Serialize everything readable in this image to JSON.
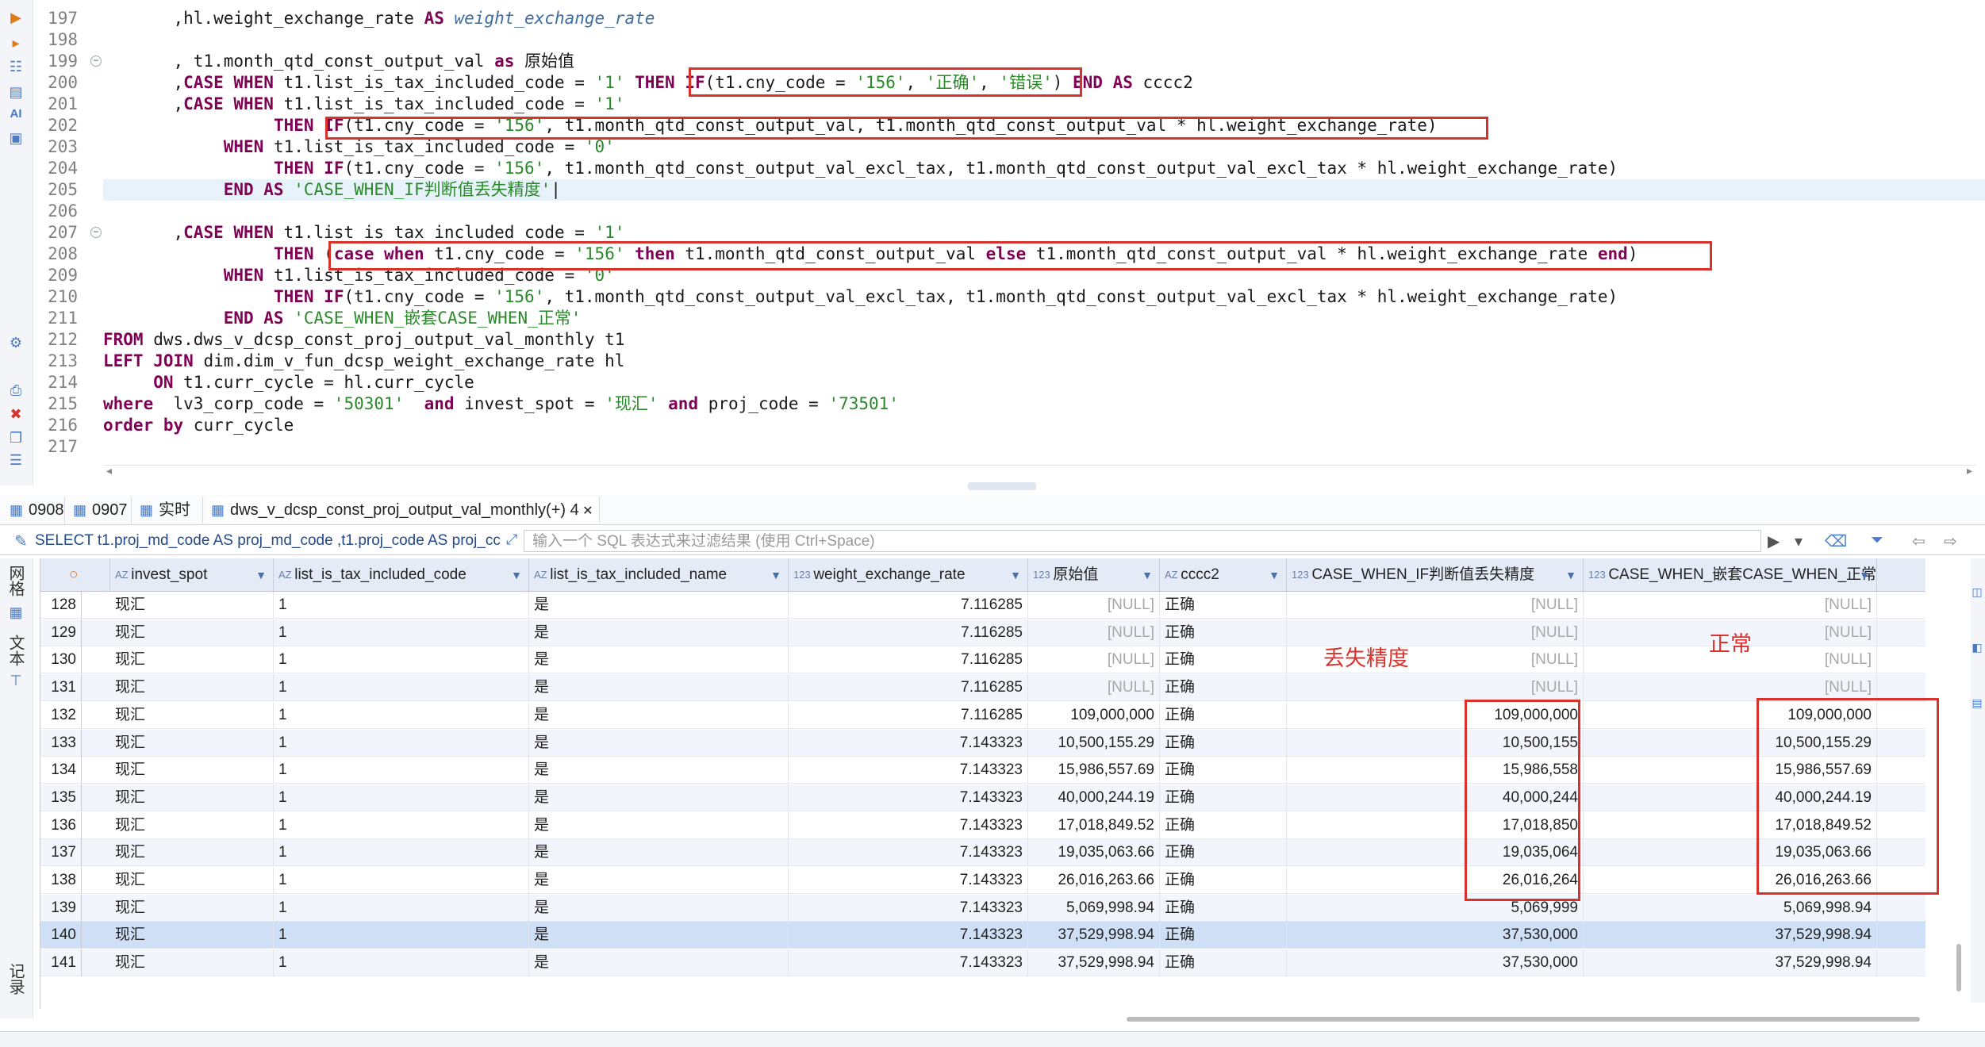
{
  "editor": {
    "lines": [
      {
        "n": "197",
        "segs": [
          [
            "p",
            "       ,hl.weight_exchange_rate "
          ],
          [
            "kw",
            "AS"
          ],
          [
            "p",
            " "
          ],
          [
            "it",
            "weight_exchange_rate"
          ]
        ]
      },
      {
        "n": "198",
        "segs": [
          [
            "p",
            ""
          ]
        ]
      },
      {
        "n": "199",
        "segs": [
          [
            "p",
            "       , t1.month_qtd_const_output_val "
          ],
          [
            "kw",
            "as"
          ],
          [
            "p",
            " 原始值"
          ]
        ],
        "fold": true
      },
      {
        "n": "200",
        "segs": [
          [
            "p",
            "       ,"
          ],
          [
            "kw",
            "CASE WHEN"
          ],
          [
            "p",
            " t1.list_is_tax_included_code = "
          ],
          [
            "str",
            "'1'"
          ],
          [
            "p",
            " "
          ],
          [
            "kw",
            "THEN"
          ],
          [
            "p",
            " "
          ],
          [
            "kw",
            "IF"
          ],
          [
            "p",
            "(t1.cny_code = "
          ],
          [
            "str",
            "'156'"
          ],
          [
            "p",
            ", "
          ],
          [
            "str",
            "'正确'"
          ],
          [
            "p",
            ", "
          ],
          [
            "str",
            "'错误'"
          ],
          [
            "p",
            ") "
          ],
          [
            "kw",
            "END AS"
          ],
          [
            "p",
            " cccc2"
          ]
        ]
      },
      {
        "n": "201",
        "segs": [
          [
            "p",
            "       ,"
          ],
          [
            "kw",
            "CASE WHEN"
          ],
          [
            "p",
            " t1.list_is_tax_included_code = "
          ],
          [
            "str",
            "'1'"
          ]
        ]
      },
      {
        "n": "202",
        "segs": [
          [
            "p",
            "                 "
          ],
          [
            "kw",
            "THEN"
          ],
          [
            "p",
            " "
          ],
          [
            "kw",
            "IF"
          ],
          [
            "p",
            "(t1.cny_code = "
          ],
          [
            "str",
            "'156'"
          ],
          [
            "p",
            ", t1.month_qtd_const_output_val, t1.month_qtd_const_output_val * hl.weight_exchange_rate)"
          ]
        ]
      },
      {
        "n": "203",
        "segs": [
          [
            "p",
            "            "
          ],
          [
            "kw",
            "WHEN"
          ],
          [
            "p",
            " t1.list_is_tax_included_code = "
          ],
          [
            "str",
            "'0'"
          ]
        ]
      },
      {
        "n": "204",
        "segs": [
          [
            "p",
            "                 "
          ],
          [
            "kw",
            "THEN"
          ],
          [
            "p",
            " "
          ],
          [
            "kw",
            "IF"
          ],
          [
            "p",
            "(t1.cny_code = "
          ],
          [
            "str",
            "'156'"
          ],
          [
            "p",
            ", t1.month_qtd_const_output_val_excl_tax, t1.month_qtd_const_output_val_excl_tax * hl.weight_exchange_rate)"
          ]
        ]
      },
      {
        "n": "205",
        "segs": [
          [
            "p",
            "            "
          ],
          [
            "kw",
            "END AS"
          ],
          [
            "p",
            " "
          ],
          [
            "str",
            "'CASE_WHEN_IF判断值丢失精度'"
          ],
          [
            "p",
            "|"
          ]
        ],
        "highlight": true
      },
      {
        "n": "206",
        "segs": [
          [
            "p",
            ""
          ]
        ]
      },
      {
        "n": "207",
        "segs": [
          [
            "p",
            "       ,"
          ],
          [
            "kw",
            "CASE WHEN"
          ],
          [
            "p",
            " t1.list_is_tax_included_code = "
          ],
          [
            "str",
            "'1'"
          ]
        ],
        "fold": true
      },
      {
        "n": "208",
        "segs": [
          [
            "p",
            "                 "
          ],
          [
            "kw",
            "THEN"
          ],
          [
            "p",
            " ("
          ],
          [
            "kw",
            "case when"
          ],
          [
            "p",
            " t1.cny_code = "
          ],
          [
            "str",
            "'156'"
          ],
          [
            "p",
            " "
          ],
          [
            "kw",
            "then"
          ],
          [
            "p",
            " t1.month_qtd_const_output_val "
          ],
          [
            "kw",
            "else"
          ],
          [
            "p",
            " t1.month_qtd_const_output_val * hl.weight_exchange_rate "
          ],
          [
            "kw",
            "end"
          ],
          [
            "p",
            ")"
          ]
        ]
      },
      {
        "n": "209",
        "segs": [
          [
            "p",
            "            "
          ],
          [
            "kw",
            "WHEN"
          ],
          [
            "p",
            " t1.list_is_tax_included_code = "
          ],
          [
            "str",
            "'0'"
          ]
        ]
      },
      {
        "n": "210",
        "segs": [
          [
            "p",
            "                 "
          ],
          [
            "kw",
            "THEN"
          ],
          [
            "p",
            " "
          ],
          [
            "kw",
            "IF"
          ],
          [
            "p",
            "(t1.cny_code = "
          ],
          [
            "str",
            "'156'"
          ],
          [
            "p",
            ", t1.month_qtd_const_output_val_excl_tax, t1.month_qtd_const_output_val_excl_tax * hl.weight_exchange_rate)"
          ]
        ]
      },
      {
        "n": "211",
        "segs": [
          [
            "p",
            "            "
          ],
          [
            "kw",
            "END AS"
          ],
          [
            "p",
            " "
          ],
          [
            "str",
            "'CASE_WHEN_嵌套CASE_WHEN_正常'"
          ]
        ]
      },
      {
        "n": "212",
        "segs": [
          [
            "kw",
            "FROM"
          ],
          [
            "p",
            " dws.dws_v_dcsp_const_proj_output_val_monthly t1"
          ]
        ]
      },
      {
        "n": "213",
        "segs": [
          [
            "kw",
            "LEFT JOIN"
          ],
          [
            "p",
            " dim.dim_v_fun_dcsp_weight_exchange_rate hl"
          ]
        ]
      },
      {
        "n": "214",
        "segs": [
          [
            "p",
            "     "
          ],
          [
            "kw",
            "ON"
          ],
          [
            "p",
            " t1.curr_cycle = hl.curr_cycle"
          ]
        ]
      },
      {
        "n": "215",
        "segs": [
          [
            "kw",
            "where"
          ],
          [
            "p",
            "  lv3_corp_code = "
          ],
          [
            "str",
            "'50301'"
          ],
          [
            "p",
            "  "
          ],
          [
            "kw",
            "and"
          ],
          [
            "p",
            " invest_spot = "
          ],
          [
            "str",
            "'现汇'"
          ],
          [
            "p",
            " "
          ],
          [
            "kw",
            "and"
          ],
          [
            "p",
            " proj_code = "
          ],
          [
            "str",
            "'73501'"
          ]
        ]
      },
      {
        "n": "216",
        "segs": [
          [
            "kw",
            "order by"
          ],
          [
            "p",
            " curr_cycle"
          ]
        ]
      },
      {
        "n": "217",
        "segs": [
          [
            "p",
            ""
          ]
        ]
      }
    ]
  },
  "tabs": [
    {
      "label": "0908",
      "icon": "table-icon"
    },
    {
      "label": "0907",
      "icon": "table-icon"
    },
    {
      "label": "实时",
      "icon": "table-icon"
    },
    {
      "label": "dws_v_dcsp_const_proj_output_val_monthly(+) 4",
      "icon": "table-icon",
      "active": true
    }
  ],
  "filter": {
    "sql": "SELECT t1.proj_md_code AS proj_md_code ,t1.proj_code AS proj_cc",
    "placeholder": "输入一个 SQL 表达式来过滤结果 (使用 Ctrl+Space)"
  },
  "side_tabs": [
    "网格",
    "文本",
    "记录"
  ],
  "columns": [
    {
      "label": "invest_spot",
      "type": "AZ"
    },
    {
      "label": "list_is_tax_included_code",
      "type": "AZ"
    },
    {
      "label": "list_is_tax_included_name",
      "type": "AZ"
    },
    {
      "label": "weight_exchange_rate",
      "type": "123"
    },
    {
      "label": "原始值",
      "type": "123"
    },
    {
      "label": "cccc2",
      "type": "AZ"
    },
    {
      "label": "CASE_WHEN_IF判断值丢失精度",
      "type": "123"
    },
    {
      "label": "CASE_WHEN_嵌套CASE_WHEN_正常",
      "type": "123"
    }
  ],
  "rows": [
    {
      "n": "128",
      "cells": [
        "现汇",
        "1",
        "是",
        "7.116285",
        "[NULL]",
        "正确",
        "[NULL]",
        "[NULL]"
      ]
    },
    {
      "n": "129",
      "cells": [
        "现汇",
        "1",
        "是",
        "7.116285",
        "[NULL]",
        "正确",
        "[NULL]",
        "[NULL]"
      ]
    },
    {
      "n": "130",
      "cells": [
        "现汇",
        "1",
        "是",
        "7.116285",
        "[NULL]",
        "正确",
        "[NULL]",
        "[NULL]"
      ]
    },
    {
      "n": "131",
      "cells": [
        "现汇",
        "1",
        "是",
        "7.116285",
        "[NULL]",
        "正确",
        "[NULL]",
        "[NULL]"
      ]
    },
    {
      "n": "132",
      "cells": [
        "现汇",
        "1",
        "是",
        "7.116285",
        "109,000,000",
        "正确",
        "109,000,000",
        "109,000,000"
      ]
    },
    {
      "n": "133",
      "cells": [
        "现汇",
        "1",
        "是",
        "7.143323",
        "10,500,155.29",
        "正确",
        "10,500,155",
        "10,500,155.29"
      ]
    },
    {
      "n": "134",
      "cells": [
        "现汇",
        "1",
        "是",
        "7.143323",
        "15,986,557.69",
        "正确",
        "15,986,558",
        "15,986,557.69"
      ]
    },
    {
      "n": "135",
      "cells": [
        "现汇",
        "1",
        "是",
        "7.143323",
        "40,000,244.19",
        "正确",
        "40,000,244",
        "40,000,244.19"
      ]
    },
    {
      "n": "136",
      "cells": [
        "现汇",
        "1",
        "是",
        "7.143323",
        "17,018,849.52",
        "正确",
        "17,018,850",
        "17,018,849.52"
      ]
    },
    {
      "n": "137",
      "cells": [
        "现汇",
        "1",
        "是",
        "7.143323",
        "19,035,063.66",
        "正确",
        "19,035,064",
        "19,035,063.66"
      ]
    },
    {
      "n": "138",
      "cells": [
        "现汇",
        "1",
        "是",
        "7.143323",
        "26,016,263.66",
        "正确",
        "26,016,264",
        "26,016,263.66"
      ]
    },
    {
      "n": "139",
      "cells": [
        "现汇",
        "1",
        "是",
        "7.143323",
        "5,069,998.94",
        "正确",
        "5,069,999",
        "5,069,998.94"
      ]
    },
    {
      "n": "140",
      "cells": [
        "现汇",
        "1",
        "是",
        "7.143323",
        "37,529,998.94",
        "正确",
        "37,530,000",
        "37,529,998.94"
      ],
      "selected": true
    },
    {
      "n": "141",
      "cells": [
        "现汇",
        "1",
        "是",
        "7.143323",
        "37,529,998.94",
        "正确",
        "37,530,000",
        "37,529,998.94"
      ]
    }
  ],
  "annotations": {
    "loss": "丢失精度",
    "normal": "正常"
  },
  "colors": {
    "annotation": "#d8322c",
    "header_bg": "#e4ebf6",
    "selected_row": "#cfe0f6",
    "keyword": "#7f0055",
    "string": "#2a8a2a"
  }
}
